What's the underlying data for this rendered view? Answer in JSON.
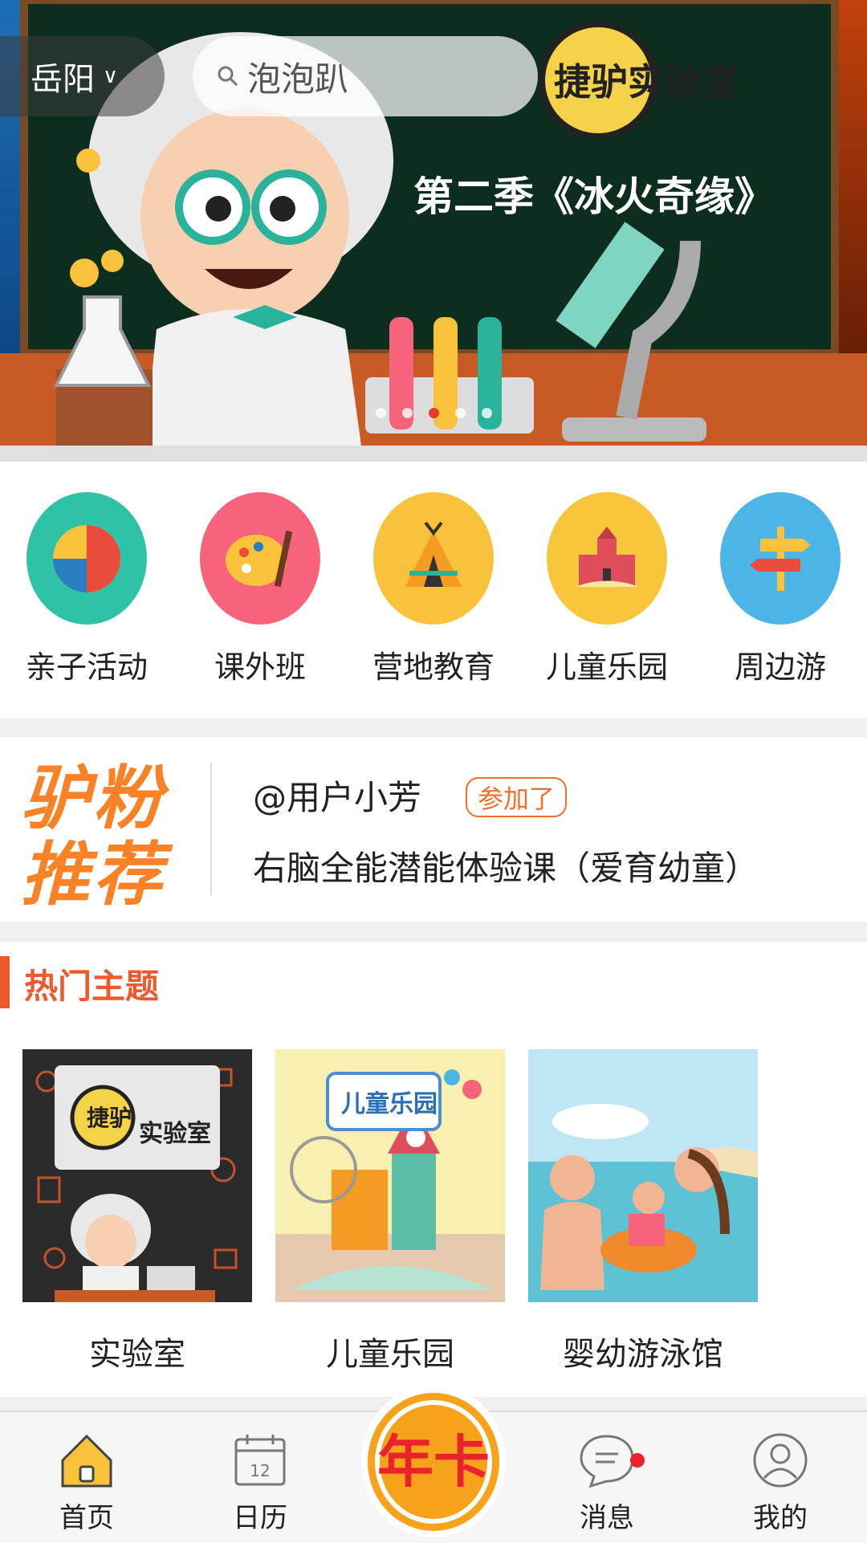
{
  "header": {
    "city": "岳阳",
    "search_placeholder": "泡泡趴",
    "banner_logo": "捷驴实验室",
    "banner_subtitle": "第二季《冰火奇缘》",
    "carousel_count": 5,
    "carousel_active": 3
  },
  "categories": [
    {
      "label": "亲子活动",
      "icon": "beach-ball-icon",
      "color": "#2ec3a6"
    },
    {
      "label": "课外班",
      "icon": "palette-icon",
      "color": "#f6637b"
    },
    {
      "label": "营地教育",
      "icon": "tent-icon",
      "color": "#f8c33b"
    },
    {
      "label": "儿童乐园",
      "icon": "castle-icon",
      "color": "#f9c53b"
    },
    {
      "label": "周边游",
      "icon": "signpost-icon",
      "color": "#4bb5e5"
    }
  ],
  "recommend": {
    "logo_line1": "驴粉",
    "logo_line2": "推荐",
    "user": "@用户小芳",
    "tag": "参加了",
    "course": "右脑全能潜能体验课（爱育幼童）"
  },
  "hot": {
    "title": "热门主题",
    "topics": [
      {
        "caption": "实验室",
        "image": "lab-cartoon-image"
      },
      {
        "caption": "儿童乐园",
        "image": "kids-park-image",
        "image_text": "儿童乐园"
      },
      {
        "caption": "婴幼游泳馆",
        "image": "swimming-family-image"
      }
    ]
  },
  "tabbar": {
    "home": "首页",
    "calendar": "日历",
    "calendar_day": "12",
    "center": "年卡",
    "messages": "消息",
    "mine": "我的"
  },
  "colors": {
    "accent": "#f98226",
    "hot_title": "#ec5a2b",
    "badge": "#e8232b"
  }
}
